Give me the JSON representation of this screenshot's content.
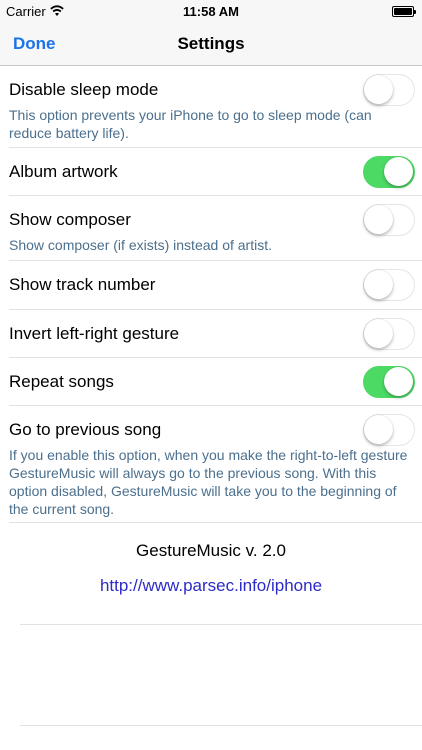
{
  "status_bar": {
    "carrier": "Carrier",
    "time": "11:58 AM"
  },
  "nav": {
    "done_label": "Done",
    "title": "Settings"
  },
  "settings": [
    {
      "label": "Disable sleep mode",
      "enabled": false,
      "description": "This option prevents your iPhone to go to sleep mode (can reduce battery life)."
    },
    {
      "label": "Album artwork",
      "enabled": true,
      "description": ""
    },
    {
      "label": "Show composer",
      "enabled": false,
      "description": "Show composer (if exists) instead of artist."
    },
    {
      "label": "Show track number",
      "enabled": false,
      "description": ""
    },
    {
      "label": "Invert left-right gesture",
      "enabled": false,
      "description": ""
    },
    {
      "label": "Repeat songs",
      "enabled": true,
      "description": ""
    },
    {
      "label": "Go to previous song",
      "enabled": false,
      "description": "If you enable this option, when you make the right-to-left gesture GestureMusic will always go to the previous song. With this option disabled, GestureMusic will take you to the beginning of the current song."
    }
  ],
  "footer": {
    "app_version": "GestureMusic v. 2.0",
    "link": "http://www.parsec.info/iphone"
  },
  "colors": {
    "accent": "#1a73e8",
    "toggle_on": "#4cd964",
    "description_text": "#4b6f8d",
    "link": "#2b2bc7"
  }
}
